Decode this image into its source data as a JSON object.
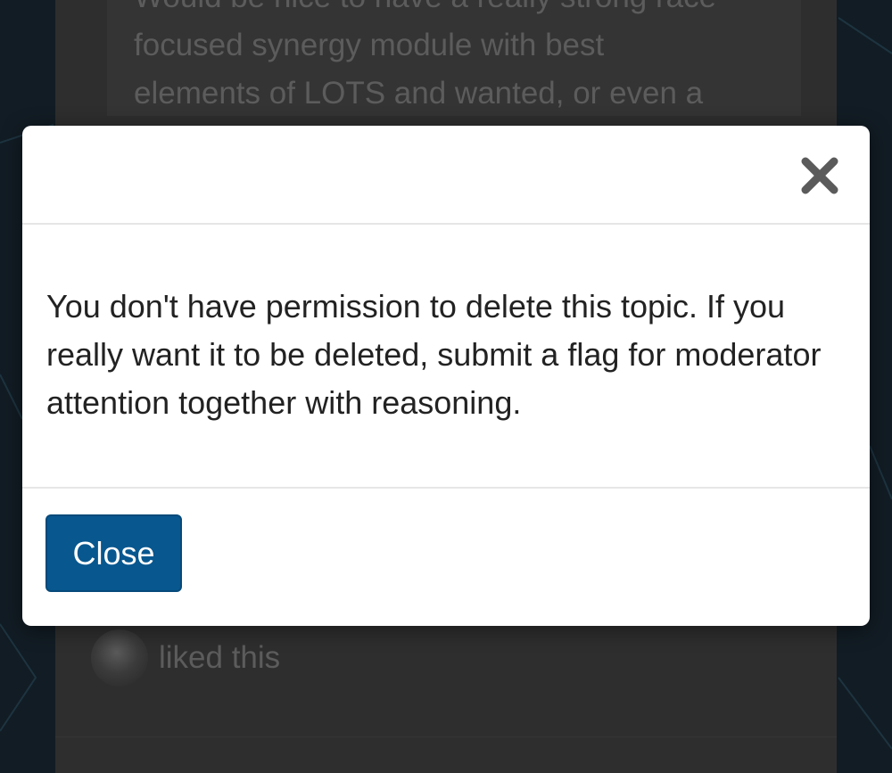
{
  "background_post": {
    "text_lines": [
      "Would be nice to have a really strong race",
      "focused synergy module with best",
      "elements of LOTS and wanted, or even a"
    ],
    "liked_label": "liked this"
  },
  "modal": {
    "close_icon": "close-x-icon",
    "message": "You don't have permission to delete this topic. If you really want it to be deleted, submit a flag for moderator attention together with reasoning.",
    "close_button_label": "Close"
  },
  "colors": {
    "primary_button": "#08578f",
    "modal_background": "#ffffff",
    "backdrop": "#121c24"
  }
}
